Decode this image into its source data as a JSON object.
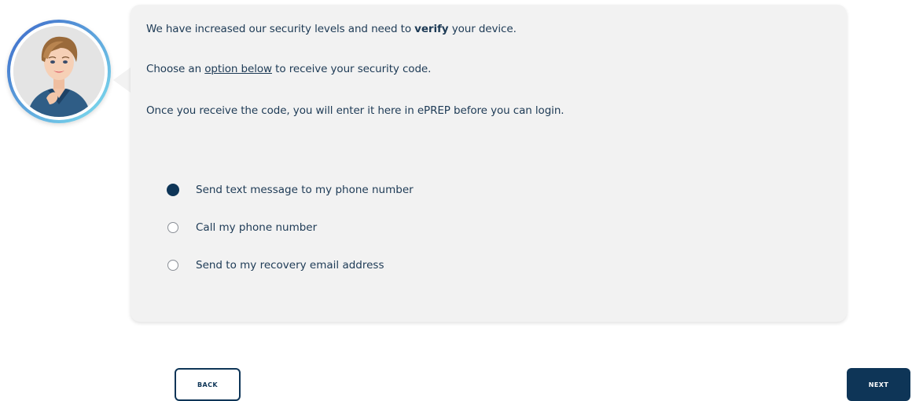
{
  "message": {
    "line1_pre": "We have increased our security levels and need to ",
    "line1_bold": "verify",
    "line1_post": " your device.",
    "line2_pre": "Choose an ",
    "line2_link": "option below",
    "line2_post": " to receive your security code.",
    "line3": "Once you receive the code, you will enter it here in ePREP before you can login."
  },
  "options": [
    {
      "label": "Send text message to my phone number",
      "checked": true
    },
    {
      "label": "Call my phone number",
      "checked": false
    },
    {
      "label": "Send to my recovery email address",
      "checked": false
    }
  ],
  "buttons": {
    "back_label": "BACK",
    "next_label": "NEXT"
  },
  "colors": {
    "primary": "#0e3557",
    "text": "#1d3a55",
    "panel": "#f2f2f2"
  },
  "icons": {
    "avatar": "assistant-avatar"
  }
}
